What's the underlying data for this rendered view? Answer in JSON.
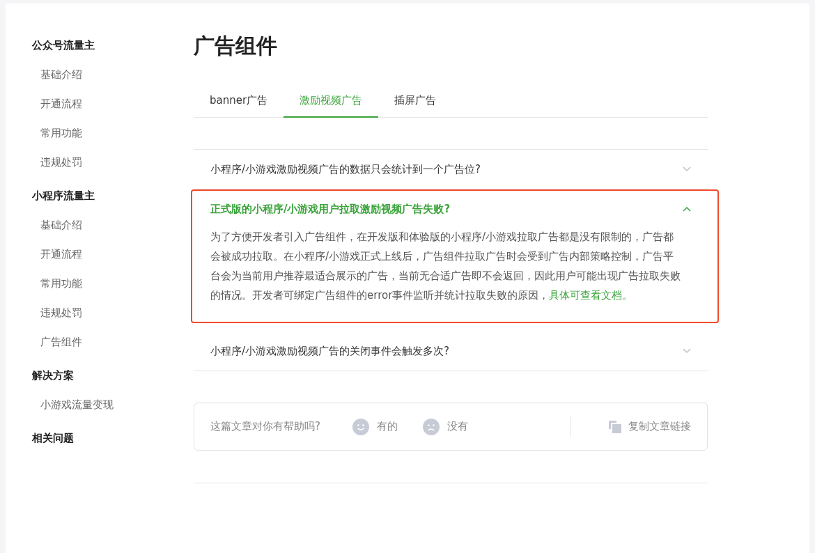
{
  "sidebar": {
    "groups": [
      {
        "title": "公众号流量主",
        "items": [
          "基础介绍",
          "开通流程",
          "常用功能",
          "违规处罚"
        ]
      },
      {
        "title": "小程序流量主",
        "items": [
          "基础介绍",
          "开通流程",
          "常用功能",
          "违规处罚",
          "广告组件"
        ]
      },
      {
        "title": "解决方案",
        "items": [
          "小游戏流量变现"
        ]
      },
      {
        "title": "相关问题"
      }
    ]
  },
  "page_title": "广告组件",
  "tabs": [
    {
      "label": "banner广告",
      "selected": false
    },
    {
      "label": "激励视频广告",
      "selected": true
    },
    {
      "label": "插屏广告",
      "selected": false
    }
  ],
  "faq": [
    {
      "question": "小程序/小游戏激励视频广告的数据只会统计到一个广告位?",
      "expanded": false,
      "highlighted": false
    },
    {
      "question": "正式版的小程序/小游戏用户拉取激励视频广告失败?",
      "expanded": true,
      "highlighted": true,
      "answer": "为了方便开发者引入广告组件，在开发版和体验版的小程序/小游戏拉取广告都是没有限制的，广告都会被成功拉取。在小程序/小游戏正式上线后，广告组件拉取广告时会受到广告内部策略控制，广告平台会为当前用户推荐最适合展示的广告，当前无合适广告即不会返回，因此用户可能出现广告拉取失败的情况。开发者可绑定广告组件的error事件监听并统计拉取失败的原因，",
      "answer_link": "具体可查看文档。"
    },
    {
      "question": "小程序/小游戏激励视频广告的关闭事件会触发多次?",
      "expanded": false,
      "highlighted": false
    }
  ],
  "feedback": {
    "prompt": "这篇文章对你有帮助吗?",
    "yes": "有的",
    "no": "没有",
    "copy": "复制文章链接"
  }
}
